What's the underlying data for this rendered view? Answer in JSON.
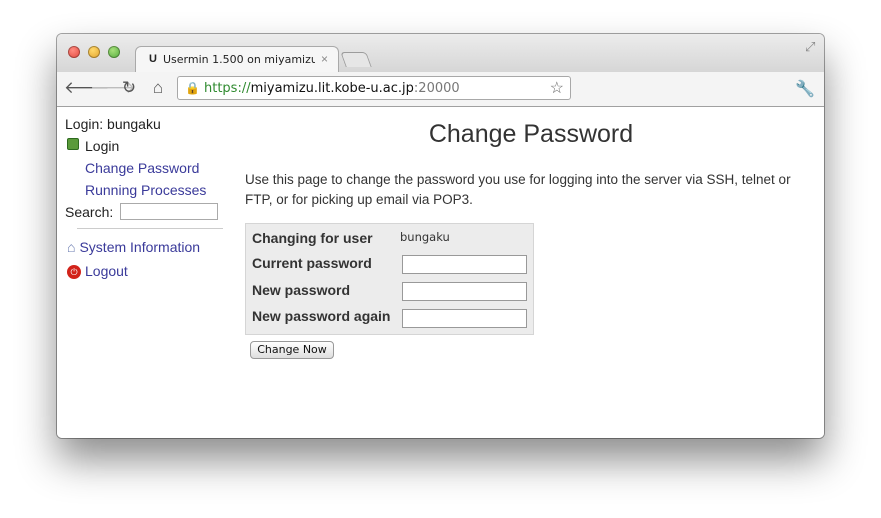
{
  "browser": {
    "tab_title": "Usermin 1.500 on miyamizu",
    "tab_favicon": "U",
    "tab_close": "×",
    "url_scheme": "https://",
    "url_host": "miyamizu.lit.kobe-u.ac.jp",
    "url_port": ":20000",
    "icons": {
      "back": "back-arrow-icon",
      "forward": "forward-arrow-icon",
      "reload": "reload-icon",
      "home": "home-icon",
      "lock": "lock-icon",
      "bookmark": "star-icon",
      "settings": "wrench-icon",
      "fullscreen": "fullscreen-icon"
    }
  },
  "sidebar": {
    "login_text": "Login: bungaku",
    "login_section": "Login",
    "items": [
      {
        "label": "Change Password"
      },
      {
        "label": "Running Processes"
      }
    ],
    "search_label": "Search:",
    "system_information": "System Information",
    "logout": "Logout"
  },
  "main": {
    "title": "Change Password",
    "intro": "Use this page to change the password you use for logging into the server via SSH, telnet or FTP, or for picking up email via POP3.",
    "form": {
      "user_label": "Changing for user",
      "user_value": "bungaku",
      "current_label": "Current password",
      "new_label": "New password",
      "again_label": "New password again",
      "submit": "Change Now"
    }
  },
  "colors": {
    "link": "#3a3a9a",
    "secure_scheme": "#2f8a2f",
    "form_background": "#ececec"
  }
}
